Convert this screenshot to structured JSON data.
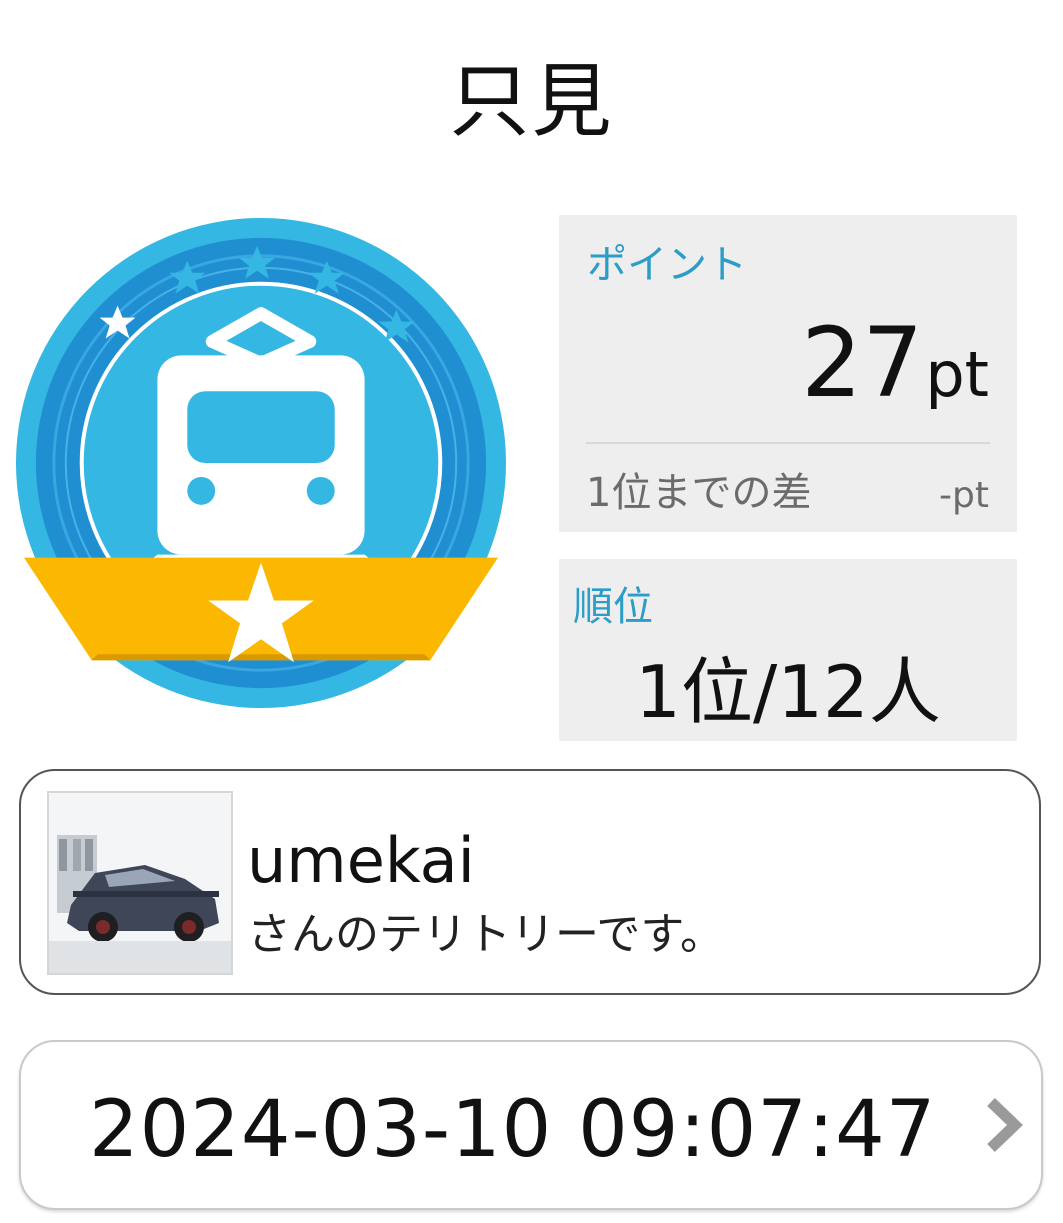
{
  "header": {
    "title": "只見"
  },
  "badge": {
    "icon": "train-badge-icon",
    "colors": {
      "outer": "#34b7e2",
      "ring": "#1f8fd1",
      "ribbon": "#fcb700"
    }
  },
  "points": {
    "label": "ポイント",
    "value": "27",
    "unit": "pt",
    "diff_label": "1位までの差",
    "diff_value": "-pt"
  },
  "rank": {
    "label": "順位",
    "value": "1位/12人"
  },
  "owner": {
    "name": "umekai",
    "suffix": "さんのテリトリーです。"
  },
  "timestamp": {
    "value": "2024-03-10 09:07:47",
    "icon": "chevron-right-icon"
  },
  "colors": {
    "accent": "#2c9cc8",
    "panel_bg": "#eeeeee"
  }
}
